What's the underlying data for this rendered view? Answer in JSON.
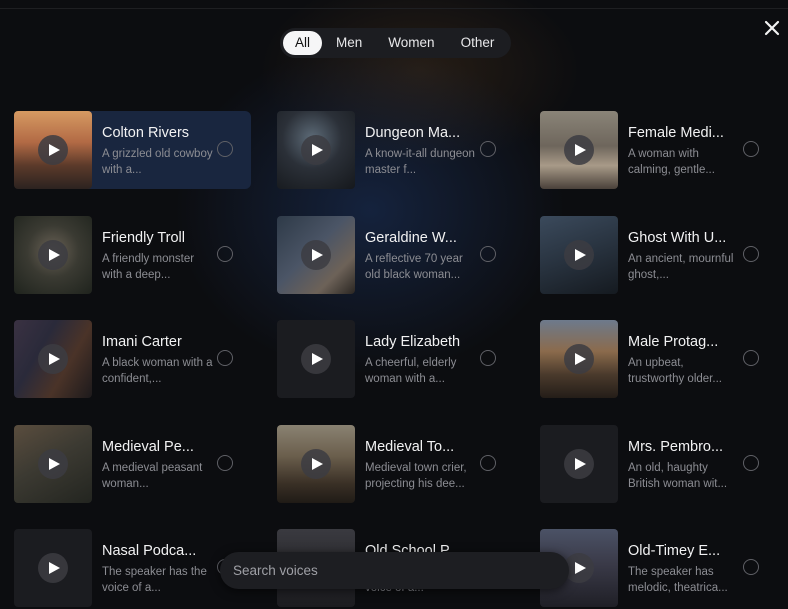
{
  "filters": {
    "active": "All",
    "tabs": [
      "All",
      "Men",
      "Women",
      "Other"
    ]
  },
  "search": {
    "placeholder": "Search voices"
  },
  "voices": [
    {
      "name": "Colton Rivers",
      "description": "A grizzled old cowboy with a...",
      "selected": true,
      "thumb": "cowboy-desert"
    },
    {
      "name": "Dungeon Ma...",
      "description": "A know-it-all dungeon master f...",
      "selected": false,
      "thumb": "dungeon-master"
    },
    {
      "name": "Female Medi...",
      "description": "A woman with calming, gentle...",
      "selected": false,
      "thumb": "meditation-room"
    },
    {
      "name": "Friendly Troll",
      "description": "A friendly monster with a deep...",
      "selected": false,
      "thumb": "troll-forest"
    },
    {
      "name": "Geraldine W...",
      "description": "A reflective 70 year old black woman...",
      "selected": false,
      "thumb": "library-woman"
    },
    {
      "name": "Ghost With U...",
      "description": "An ancient, mournful ghost,...",
      "selected": false,
      "thumb": "ghost-room"
    },
    {
      "name": "Imani Carter",
      "description": "A black woman with a confident,...",
      "selected": false,
      "thumb": "woman-portrait"
    },
    {
      "name": "Lady Elizabeth",
      "description": "A cheerful, elderly woman with a...",
      "selected": false,
      "thumb": "blank"
    },
    {
      "name": "Male Protag...",
      "description": "An upbeat, trustworthy older...",
      "selected": false,
      "thumb": "man-lake"
    },
    {
      "name": "Medieval Pe...",
      "description": "A medieval peasant woman...",
      "selected": false,
      "thumb": "peasant-couple"
    },
    {
      "name": "Medieval To...",
      "description": "Medieval town crier, projecting his dee...",
      "selected": false,
      "thumb": "town-crier"
    },
    {
      "name": "Mrs. Pembro...",
      "description": "An old, haughty British woman wit...",
      "selected": false,
      "thumb": "blank"
    },
    {
      "name": "Nasal Podca...",
      "description": "The speaker has the voice of a...",
      "selected": false,
      "thumb": "blank"
    },
    {
      "name": "Old School P...",
      "description": "The speaker has the voice of a...",
      "selected": false,
      "thumb": "old-school"
    },
    {
      "name": "Old-Timey E...",
      "description": "The speaker has melodic, theatrica...",
      "selected": false,
      "thumb": "old-timey"
    }
  ]
}
